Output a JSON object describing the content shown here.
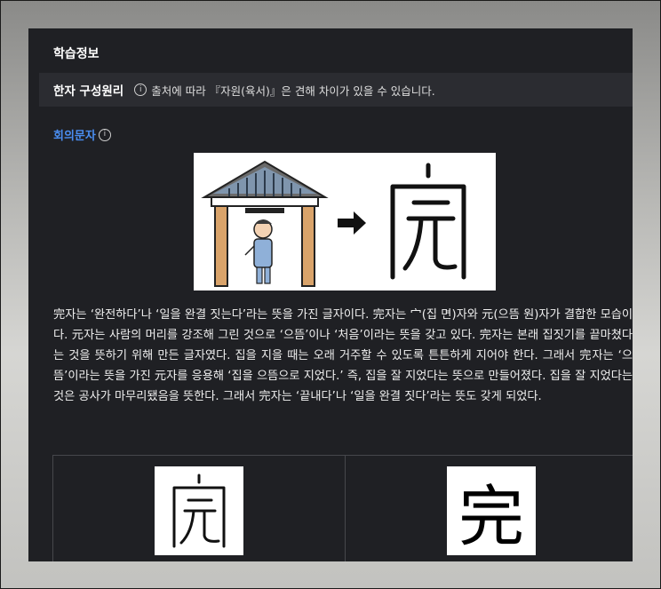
{
  "panel": {
    "title": "학습정보"
  },
  "info_bar": {
    "label": "한자 구성원리",
    "icon": "info-icon",
    "text": "출처에 따라 『자원(육서)』은 견해 차이가 있을 수 있습니다."
  },
  "classification": {
    "label": "회의문자",
    "icon": "info-icon"
  },
  "description": "完자는 ‘완전하다’나 ‘일을 완결 짓는다’라는 뜻을 가진 글자이다. 完자는 宀(집 면)자와 元(으뜸 원)자가 결합한 모습이다. 元자는 사람의 머리를 강조해 그린 것으로 ‘으뜸’이나 ‘처음’이라는 뜻을 갖고 있다. 完자는 본래 집짓기를 끝마쳤다는 것을 뜻하기 위해 만든 글자였다. 집을 지을 때는 오래 거주할 수 있도록 튼튼하게 지어야 한다. 그래서 完자는 ‘으뜸’이라는 뜻을 가진 元자를 응용해 ‘집을 으뜸으로 지었다.’ 즉, 집을 잘 지었다는 뜻으로 만들어졌다. 집을 잘 지었다는 것은 공사가 마무리됐음을 뜻한다. 그래서 完자는 ‘끝내다’나 ‘일을 완결 짓다’라는 뜻도 갖게 되었다.",
  "glyphs": {
    "kaishu": "完"
  }
}
